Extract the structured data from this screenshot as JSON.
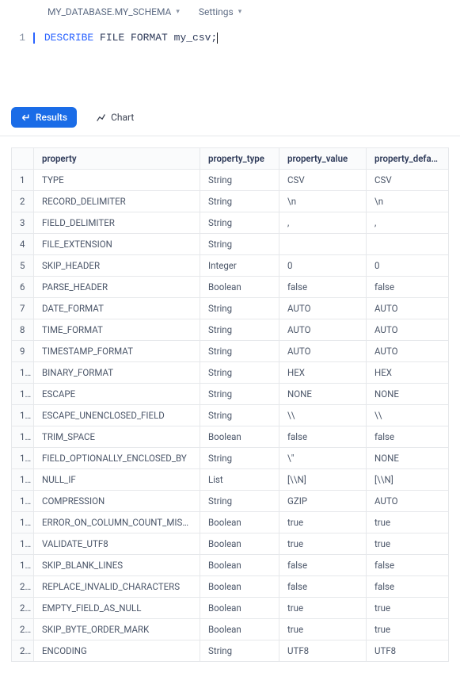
{
  "header": {
    "database_label": "MY_DATABASE.MY_SCHEMA",
    "settings_label": "Settings"
  },
  "editor": {
    "line_number": "1",
    "keyword": "DESCRIBE",
    "rest": " FILE FORMAT my_csv;"
  },
  "tabs": {
    "results_label": "Results",
    "chart_label": "Chart"
  },
  "table": {
    "columns": [
      "property",
      "property_type",
      "property_value",
      "property_default"
    ],
    "rows": [
      [
        "TYPE",
        "String",
        "CSV",
        "CSV"
      ],
      [
        "RECORD_DELIMITER",
        "String",
        "\\n",
        "\\n"
      ],
      [
        "FIELD_DELIMITER",
        "String",
        ",",
        ","
      ],
      [
        "FILE_EXTENSION",
        "String",
        "",
        ""
      ],
      [
        "SKIP_HEADER",
        "Integer",
        "0",
        "0"
      ],
      [
        "PARSE_HEADER",
        "Boolean",
        "false",
        "false"
      ],
      [
        "DATE_FORMAT",
        "String",
        "AUTO",
        "AUTO"
      ],
      [
        "TIME_FORMAT",
        "String",
        "AUTO",
        "AUTO"
      ],
      [
        "TIMESTAMP_FORMAT",
        "String",
        "AUTO",
        "AUTO"
      ],
      [
        "BINARY_FORMAT",
        "String",
        "HEX",
        "HEX"
      ],
      [
        "ESCAPE",
        "String",
        "NONE",
        "NONE"
      ],
      [
        "ESCAPE_UNENCLOSED_FIELD",
        "String",
        "\\\\",
        "\\\\"
      ],
      [
        "TRIM_SPACE",
        "Boolean",
        "false",
        "false"
      ],
      [
        "FIELD_OPTIONALLY_ENCLOSED_BY",
        "String",
        "\\\"",
        "NONE"
      ],
      [
        "NULL_IF",
        "List",
        "[\\\\N]",
        "[\\\\N]"
      ],
      [
        "COMPRESSION",
        "String",
        "GZIP",
        "AUTO"
      ],
      [
        "ERROR_ON_COLUMN_COUNT_MISMATCH",
        "Boolean",
        "true",
        "true"
      ],
      [
        "VALIDATE_UTF8",
        "Boolean",
        "true",
        "true"
      ],
      [
        "SKIP_BLANK_LINES",
        "Boolean",
        "false",
        "false"
      ],
      [
        "REPLACE_INVALID_CHARACTERS",
        "Boolean",
        "false",
        "false"
      ],
      [
        "EMPTY_FIELD_AS_NULL",
        "Boolean",
        "true",
        "true"
      ],
      [
        "SKIP_BYTE_ORDER_MARK",
        "Boolean",
        "true",
        "true"
      ],
      [
        "ENCODING",
        "String",
        "UTF8",
        "UTF8"
      ]
    ]
  }
}
